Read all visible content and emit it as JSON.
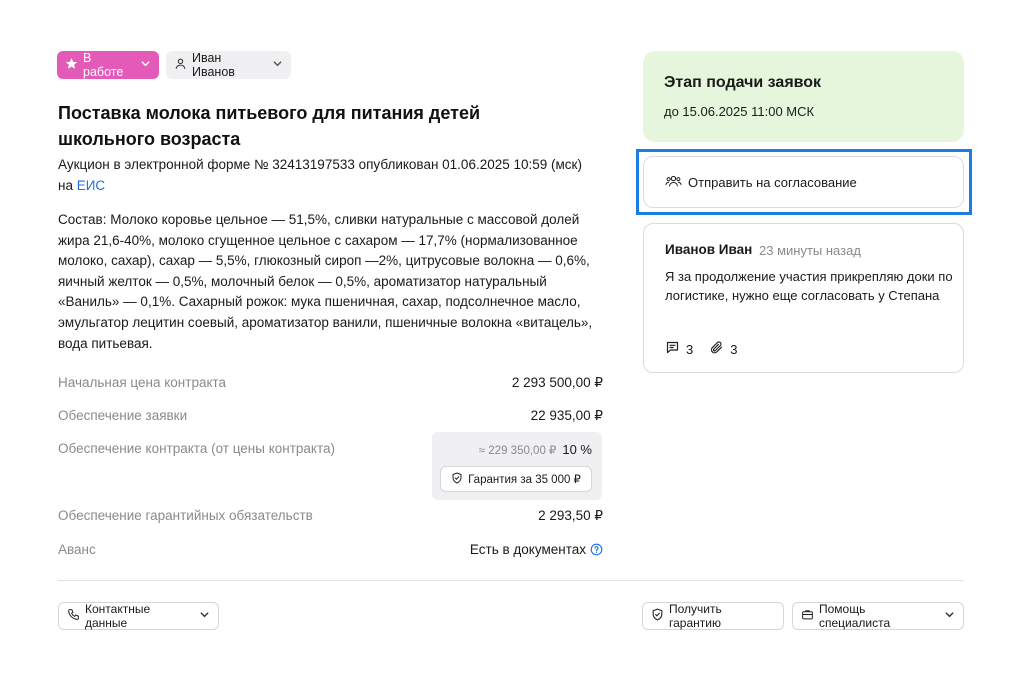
{
  "header": {
    "status_label": "В работе",
    "assignee_label": "Иван Иванов"
  },
  "tender": {
    "title": "Поставка молока питьевого для питания детей школьного возраста",
    "subtitle_text": "Аукцион в электронной форме № 32413197533 опубликован 01.06.2025 10:59 (мск) на ",
    "subtitle_link": "ЕИС",
    "composition": "Состав: Молоко коровье цельное — 51,5%, сливки натуральные с массовой долей жира 21,6-40%, молоко сгущенное цельное с сахаром — 17,7% (нормализованное молоко, сахар), сахар — 5,5%, глюкозный сироп —2%, цитрусовые волокна — 0,6%, яичный желток — 0,5%, молочный белок — 0,5%, ароматизатор натуральный «Ваниль» — 0,1%. Сахарный рожок: мука пшеничная, сахар, подсолнечное масло, эмульгатор лецитин соевый, ароматизатор ванили, пшеничные волокна «витацель», вода питьевая."
  },
  "params": {
    "start_price_label": "Начальная цена контракта",
    "start_price_value": "2 293 500,00 ₽",
    "app_security_label": "Обеспечение заявки",
    "app_security_value": "22 935,00 ₽",
    "contract_security_label": "Обеспечение контракта (от цены контракта)",
    "contract_security_amount": "≈ 229 350,00 ₽",
    "contract_security_percent": "10 %",
    "guarantee_button_label": "Гарантия за 35 000 ₽",
    "warranty_security_label": "Обеспечение гарантийных обязательств",
    "warranty_security_value": "2 293,50 ₽",
    "advance_label": "Аванс",
    "advance_value": "Есть в документах"
  },
  "footer": {
    "contacts_label": "Контактные данные",
    "get_guarantee_label": "Получить гарантию",
    "specialist_help_label": "Помощь специалиста"
  },
  "stage": {
    "title": "Этап подачи заявок",
    "deadline": "до 15.06.2025 11:00 МСК"
  },
  "approval": {
    "send_label": "Отправить на согласование"
  },
  "comment": {
    "author": "Иванов Иван",
    "time": "23 минуты назад",
    "text": "Я за продолжение участия прикрепляю доки по логистике, нужно еще согласовать у Степана",
    "replies_count": "3",
    "attachments_count": "3"
  },
  "colors": {
    "status_chip": "#e45ab8",
    "stage_card": "#e6f6dc",
    "link": "#1e6fe8",
    "highlight": "#1a7fe0"
  }
}
